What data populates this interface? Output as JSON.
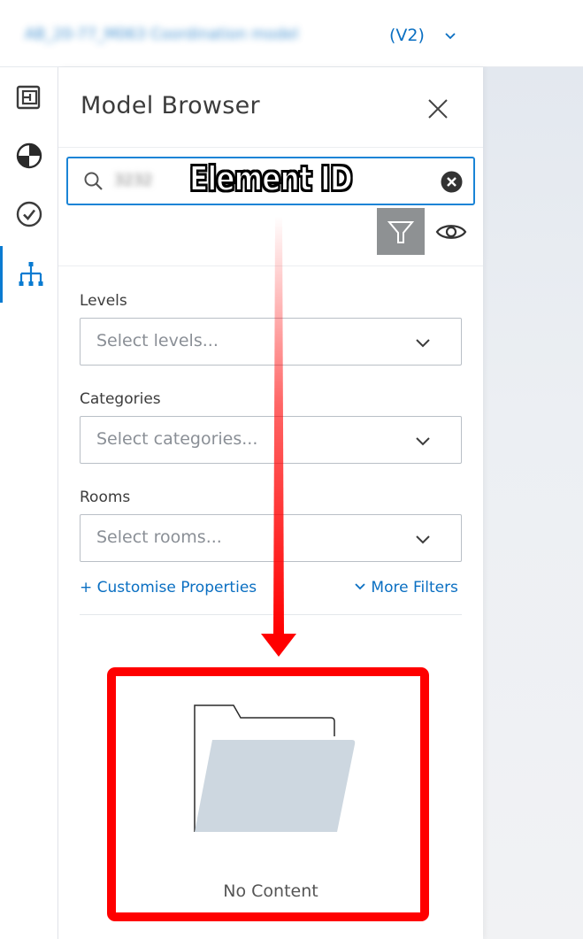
{
  "topbar": {
    "file_name": "AB_20-77_M063 Coordination model",
    "version": "(V2)"
  },
  "rail": {
    "items": [
      {
        "icon": "sheets-icon"
      },
      {
        "icon": "model-icon"
      },
      {
        "icon": "issues-check-icon"
      },
      {
        "icon": "hierarchy-icon",
        "active": true
      }
    ]
  },
  "panel": {
    "title": "Model Browser",
    "search": {
      "value": "3232",
      "overlay_label": "Element ID"
    },
    "levels": {
      "label": "Levels",
      "placeholder": "Select levels..."
    },
    "categories": {
      "label": "Categories",
      "placeholder": "Select categories..."
    },
    "rooms": {
      "label": "Rooms",
      "placeholder": "Select rooms..."
    },
    "customise_link": "+ Customise Properties",
    "more_filters_link": "More Filters",
    "empty_state": "No Content"
  },
  "colors": {
    "accent": "#0a6fc2",
    "focus_border": "#1a84d6",
    "annotation_red": "#ff0000",
    "folder_fill": "#cdd7e0",
    "filter_button": "#8e9193"
  }
}
